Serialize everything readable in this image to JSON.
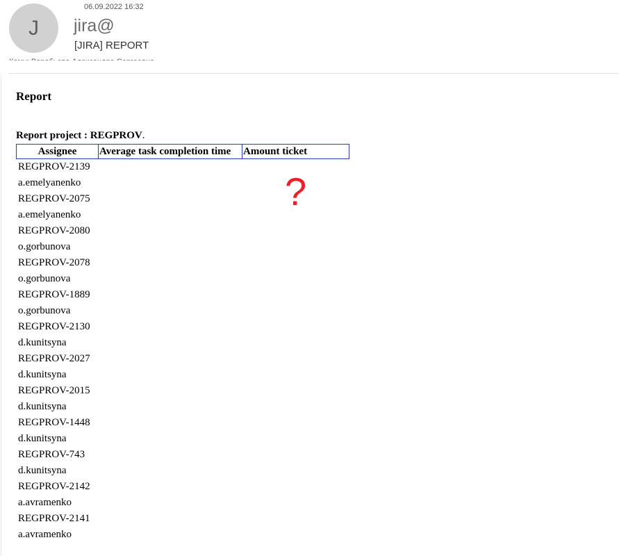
{
  "email": {
    "avatar_letter": "J",
    "date": "06.09.2022 16:32",
    "sender": "jira@",
    "subject": "[JIRA] REPORT",
    "to_line": "Кому: Воробьева Александра Сергеевна"
  },
  "report": {
    "heading": "Report",
    "project_label": "Report project : REGPROV",
    "project_dot": ".",
    "columns": [
      "Assignee",
      "Average task completion time",
      "Amount ticket"
    ],
    "rows": [
      "REGPROV-2139",
      "a.emelyanenko",
      "REGPROV-2075",
      "a.emelyanenko",
      "REGPROV-2080",
      "o.gorbunova",
      "REGPROV-2078",
      "o.gorbunova",
      "REGPROV-1889",
      "o.gorbunova",
      "REGPROV-2130",
      "d.kunitsyna",
      "REGPROV-2027",
      "d.kunitsyna",
      "REGPROV-2015",
      "d.kunitsyna",
      "REGPROV-1448",
      "d.kunitsyna",
      "REGPROV-743",
      "d.kunitsyna",
      "REGPROV-2142",
      "a.avramenko",
      "REGPROV-2141",
      "a.avramenko"
    ]
  },
  "annotation": {
    "question_mark": "?",
    "color": "#e8202a"
  }
}
